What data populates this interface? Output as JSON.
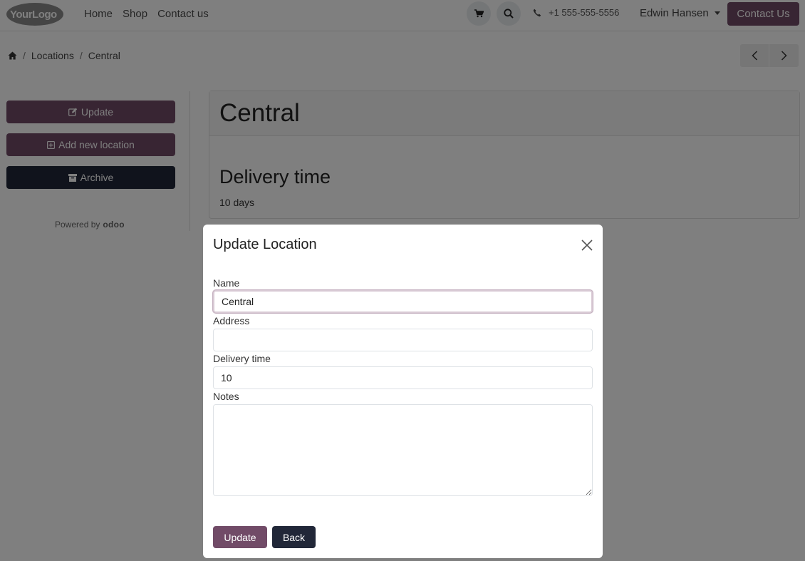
{
  "navbar": {
    "logo_text": "YourLogo",
    "links": [
      "Home",
      "Shop",
      "Contact us"
    ],
    "phone": "+1 555-555-5556",
    "user": "Edwin Hansen",
    "contact_button": "Contact Us"
  },
  "breadcrumb": {
    "items": [
      "Locations",
      "Central"
    ]
  },
  "sidebar": {
    "update_label": "Update",
    "add_label": "Add new location",
    "archive_label": "Archive",
    "powered_by": "Powered by",
    "powered_brand": "odoo"
  },
  "record": {
    "title": "Central",
    "delivery_heading": "Delivery time",
    "delivery_value": "10 days"
  },
  "modal": {
    "title": "Update Location",
    "fields": {
      "name_label": "Name",
      "name_value": "Central",
      "address_label": "Address",
      "address_value": "",
      "delivery_label": "Delivery time",
      "delivery_value": "10",
      "notes_label": "Notes",
      "notes_value": ""
    },
    "update_button": "Update",
    "back_button": "Back"
  },
  "colors": {
    "primary": "#714b67",
    "secondary": "#212738",
    "backdrop": "rgba(0,0,0,0.5)"
  }
}
